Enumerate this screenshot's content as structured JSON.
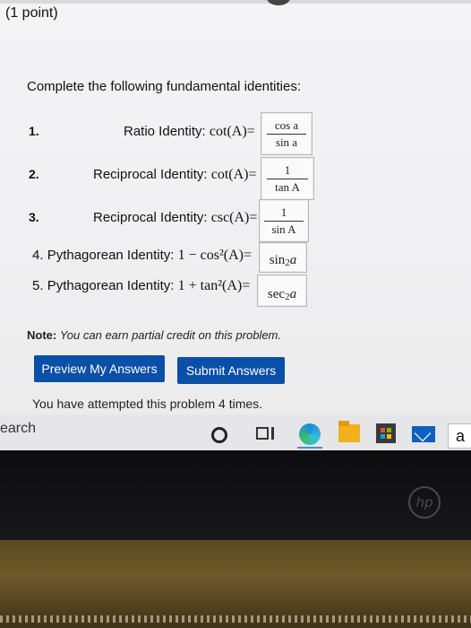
{
  "header": {
    "points": "(1 point)"
  },
  "instruction": "Complete the following fundamental identities:",
  "identities": [
    {
      "num": "1.",
      "label": "Ratio Identity: ",
      "lhs": "cot(A)=",
      "answer_num": "cos a",
      "answer_den": "sin a"
    },
    {
      "num": "2.",
      "label": "Reciprocal Identity: ",
      "lhs": "cot(A)=",
      "answer_num": "1",
      "answer_den": "tan A"
    },
    {
      "num": "3.",
      "label": "Reciprocal Identity: ",
      "lhs": "csc(A)=",
      "answer_num": "1",
      "answer_den": "sin A"
    },
    {
      "num": "4.",
      "label": "Pythagorean Identity: ",
      "lhs": "1 − cos²(A)=",
      "answer_base": "sin",
      "answer_exp": "2",
      "answer_var": "a"
    },
    {
      "num": "5.",
      "label": "Pythagorean Identity: ",
      "lhs": "1 + tan²(A)=",
      "answer_base": "sec",
      "answer_exp": "2",
      "answer_var": "a"
    }
  ],
  "note": {
    "prefix": "Note:",
    "text": "You can earn partial credit on this problem."
  },
  "buttons": {
    "preview": "Preview My Answers",
    "submit": "Submit Answers"
  },
  "attempted": "You have attempted this problem 4 times.",
  "taskbar": {
    "search_fragment": "earch",
    "amazon_letter": "a"
  },
  "bezel": {
    "logo": "hp"
  },
  "colors": {
    "button_blue": "#0a4fa8",
    "screen_bg": "#f2f2f4"
  }
}
